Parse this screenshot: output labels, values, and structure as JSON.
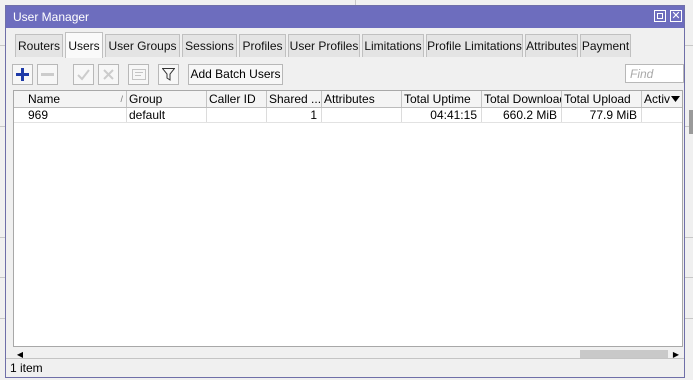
{
  "window": {
    "title": "User Manager"
  },
  "tabs": [
    {
      "label": "Routers"
    },
    {
      "label": "Users",
      "active": true
    },
    {
      "label": "User Groups"
    },
    {
      "label": "Sessions"
    },
    {
      "label": "Profiles"
    },
    {
      "label": "User Profiles"
    },
    {
      "label": "Limitations"
    },
    {
      "label": "Profile Limitations"
    },
    {
      "label": "Attributes"
    },
    {
      "label": "Payment"
    }
  ],
  "toolbar": {
    "add_batch_label": "Add Batch Users",
    "find_placeholder": "Find",
    "icons": [
      "plus-icon",
      "minus-icon",
      "check-icon",
      "cross-icon",
      "comment-icon",
      "filter-icon"
    ]
  },
  "table": {
    "columns": [
      "Name",
      "Group",
      "Caller ID",
      "Shared ...",
      "Attributes",
      "Total Uptime",
      "Total Download",
      "Total Upload",
      "Activ"
    ],
    "rows": [
      [
        "969",
        "default",
        "",
        "1",
        "",
        "04:41:15",
        "660.2 MiB",
        "77.9 MiB",
        ""
      ]
    ]
  },
  "status": {
    "count_text": "1 item"
  },
  "colors": {
    "titlebar": "#6d6dbe",
    "add_icon": "#1e3aa8"
  }
}
